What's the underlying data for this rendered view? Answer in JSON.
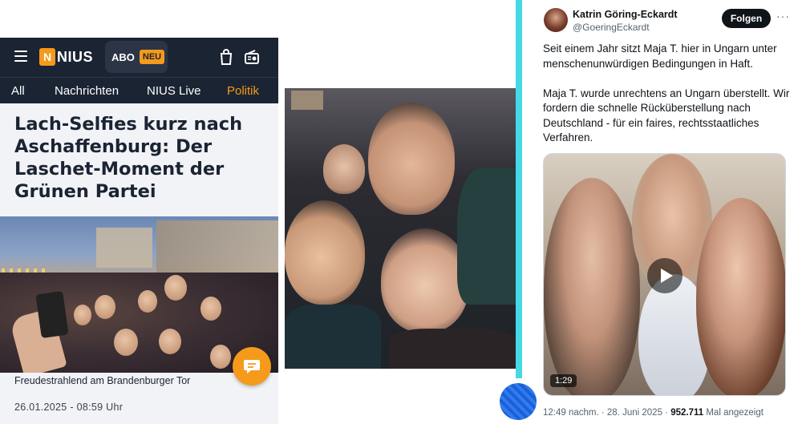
{
  "nius": {
    "logo_text": "NIUS",
    "logo_mark": "N",
    "abo_label": "ABO",
    "abo_badge": "NEU",
    "nav": [
      "All",
      "Nachrichten",
      "NIUS Live",
      "Politik"
    ],
    "active_nav": "Politik",
    "headline": "Lach-Selfies kurz nach Aschaffenburg: Der Laschet-Moment der Grünen Partei",
    "caption": "Freudestrahlend am Brandenburger Tor",
    "date": "26.01.2025 - 08:59 Uhr",
    "accent_color": "#f59a1b",
    "header_color": "#1b2433",
    "icons": [
      "menu-icon",
      "shopping-bag-icon",
      "radio-icon",
      "chat-icon"
    ]
  },
  "tweet": {
    "author_name": "Katrin Göring-Eckardt",
    "author_handle": "@GoeringEckardt",
    "follow_label": "Folgen",
    "more_label": "···",
    "paragraphs": [
      "Seit einem Jahr sitzt Maja T. hier in Ungarn unter menschenunwürdigen Bedingungen in Haft.",
      "Maja T. wurde unrechtens an Ungarn überstellt. Wir fordern die schnelle Rücküberstellung nach Deutschland - für ein faires, rechtsstaatliches Verfahren."
    ],
    "video_duration": "1:29",
    "timestamp": "12:49 nachm. · 28. Juni 2025 ·",
    "views": "952.711",
    "views_label": "Mal angezeigt"
  },
  "colors": {
    "divider": "#45d9e6"
  }
}
